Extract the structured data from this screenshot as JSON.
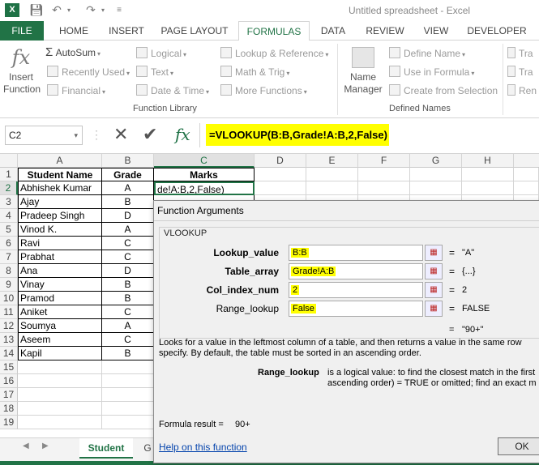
{
  "window": {
    "title": "Untitled spreadsheet - Excel",
    "app_badge": "X"
  },
  "tabs": [
    "FILE",
    "HOME",
    "INSERT",
    "PAGE LAYOUT",
    "FORMULAS",
    "DATA",
    "REVIEW",
    "VIEW",
    "DEVELOPER"
  ],
  "ribbon": {
    "insert_function": [
      "Insert",
      "Function"
    ],
    "fx_glyph": "fx",
    "library": {
      "col1": [
        "AutoSum",
        "Recently Used",
        "Financial"
      ],
      "col2": [
        "Logical",
        "Text",
        "Date & Time"
      ],
      "col3": [
        "Lookup & Reference",
        "Math & Trig",
        "More Functions"
      ],
      "group_label": "Function Library"
    },
    "name_manager": [
      "Name",
      "Manager"
    ],
    "defined": {
      "items": [
        "Define Name",
        "Use in Formula",
        "Create from Selection"
      ],
      "group_label": "Defined Names"
    },
    "audit": [
      "Tra",
      "Tra",
      "Ren"
    ]
  },
  "formula_bar": {
    "name_box": "C2",
    "formula": "=VLOOKUP(B:B,Grade!A:B,2,False)"
  },
  "grid": {
    "columns": [
      "A",
      "B",
      "C",
      "D",
      "E",
      "F",
      "G",
      "H"
    ],
    "rows": [
      {
        "n": "1",
        "a": "Student Name",
        "b": "Grade",
        "c": "Marks"
      },
      {
        "n": "2",
        "a": "Abhishek Kumar",
        "b": "A",
        "c": "de!A:B,2,False)"
      },
      {
        "n": "3",
        "a": "Ajay",
        "b": "B",
        "c": ""
      },
      {
        "n": "4",
        "a": "Pradeep Singh",
        "b": "D",
        "c": ""
      },
      {
        "n": "5",
        "a": "Vinod K.",
        "b": "A",
        "c": ""
      },
      {
        "n": "6",
        "a": "Ravi",
        "b": "C",
        "c": ""
      },
      {
        "n": "7",
        "a": "Prabhat",
        "b": "C",
        "c": ""
      },
      {
        "n": "8",
        "a": "Ana",
        "b": "D",
        "c": ""
      },
      {
        "n": "9",
        "a": "Vinay",
        "b": "B",
        "c": ""
      },
      {
        "n": "10",
        "a": "Pramod",
        "b": "B",
        "c": ""
      },
      {
        "n": "11",
        "a": "Aniket",
        "b": "C",
        "c": ""
      },
      {
        "n": "12",
        "a": "Soumya",
        "b": "A",
        "c": ""
      },
      {
        "n": "13",
        "a": "Aseem",
        "b": "C",
        "c": ""
      },
      {
        "n": "14",
        "a": "Kapil",
        "b": "B",
        "c": ""
      },
      {
        "n": "15",
        "a": "",
        "b": "",
        "c": ""
      },
      {
        "n": "16",
        "a": "",
        "b": "",
        "c": ""
      },
      {
        "n": "17",
        "a": "",
        "b": "",
        "c": ""
      },
      {
        "n": "18",
        "a": "",
        "b": "",
        "c": ""
      },
      {
        "n": "19",
        "a": "",
        "b": "",
        "c": ""
      }
    ]
  },
  "sheet_tabs": [
    "Student",
    "G"
  ],
  "dialog": {
    "title": "Function Arguments",
    "function_name": "VLOOKUP",
    "args": [
      {
        "label": "Lookup_value",
        "value": "B:B",
        "result": "\"A\""
      },
      {
        "label": "Table_array",
        "value": "Grade!A:B",
        "result": "{...}"
      },
      {
        "label": "Col_index_num",
        "value": "2",
        "result": "2"
      },
      {
        "label": "Range_lookup",
        "value": "False",
        "result": "FALSE"
      }
    ],
    "overall_result": "\"90+\"",
    "eq": "=",
    "description": "Looks for a value in the leftmost column of a table, and then returns a value in the same row",
    "description2": "specify. By default, the table must be sorted in an ascending order.",
    "arg_help_label": "Range_lookup",
    "arg_help_text1": "is a logical value: to find the closest match in the first",
    "arg_help_text2": "ascending order) = TRUE or omitted; find an exact m",
    "formula_result_label": "Formula result =",
    "formula_result_value": "90+",
    "help_link": "Help on this function",
    "ok": "OK"
  }
}
